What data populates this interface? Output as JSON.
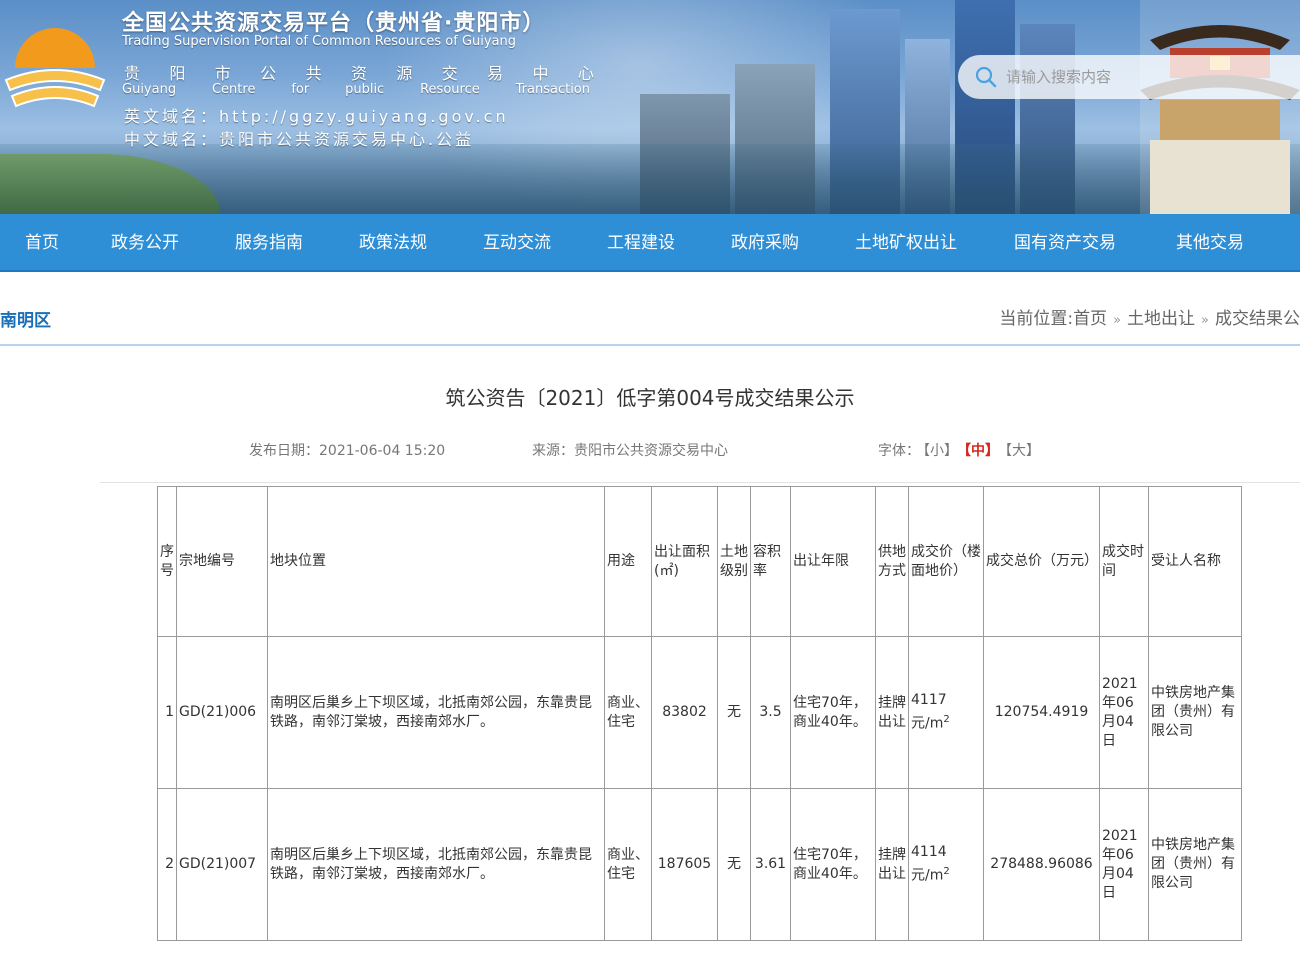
{
  "header": {
    "title": "全国公共资源交易平台（贵州省·贵阳市）",
    "subtitle": "Trading Supervision Portal of Common Resources of Guiyang",
    "center_name_cn": [
      "贵",
      "阳",
      "市",
      "公",
      "共",
      "资",
      "源",
      "交",
      "易",
      "中",
      "心"
    ],
    "center_name_en": [
      "Guiyang",
      "Centre",
      "for",
      "public",
      "Resource",
      "Transaction"
    ],
    "en_domain_label": "英文域名：",
    "en_domain": "http://ggzy.guiyang.gov.cn",
    "cn_domain_label": "中文域名：",
    "cn_domain": "贵阳市公共资源交易中心.公益",
    "search_placeholder": "请输入搜索内容"
  },
  "nav": {
    "items": [
      "首页",
      "政务公开",
      "服务指南",
      "政策法规",
      "互动交流",
      "工程建设",
      "政府采购",
      "土地矿权出让",
      "国有资产交易",
      "其他交易"
    ]
  },
  "breadcrumb": {
    "section": "南明区",
    "prefix": "当前位置:",
    "items": [
      "首页",
      "土地出让",
      "成交结果公"
    ],
    "separator": "»"
  },
  "article": {
    "title": "筑公资告〔2021〕低字第004号成交结果公示",
    "publish_label": "发布日期：",
    "publish_date": "2021-06-04 15:20",
    "source_label": "来源：",
    "source": "贵阳市公共资源交易中心",
    "font_label": "字体：",
    "font_small": "【小】",
    "font_medium": "【中】",
    "font_large": "【大】"
  },
  "table": {
    "headers": [
      "序号",
      "宗地编号",
      "地块位置",
      "用途",
      "出让面积(㎡)",
      "土地级别",
      "容积率",
      "出让年限",
      "供地方式",
      "成交价（楼面地价）",
      "成交总价（万元）",
      "成交时间",
      "受让人名称"
    ],
    "rows": [
      {
        "no": "1",
        "parcel_id": "GD(21)006",
        "location": "南明区后巢乡上下坝区域，北抵南郊公园，东靠贵昆铁路，南邻汀棠坡，西接南郊水厂。",
        "use": "商业、住宅",
        "area": "83802",
        "land_grade": "无",
        "plot_ratio": "3.5",
        "term": "住宅70年，商业40年。",
        "supply_method": "挂牌出让",
        "unit_price": "4117",
        "unit_price_unit": "元/m",
        "total_price": "120754.4919",
        "deal_time": "2021年06月04日",
        "buyer": "中铁房地产集团（贵州）有限公司"
      },
      {
        "no": "2",
        "parcel_id": "GD(21)007",
        "location": "南明区后巢乡上下坝区域，北抵南郊公园，东靠贵昆铁路，南邻汀棠坡，西接南郊水厂。",
        "use": "商业、住宅",
        "area": "187605",
        "land_grade": "无",
        "plot_ratio": "3.61",
        "term": "住宅70年，商业40年。",
        "supply_method": "挂牌出让",
        "unit_price": "4114",
        "unit_price_unit": "元/m",
        "total_price": "278488.96086",
        "deal_time": "2021年06月04日",
        "buyer": "中铁房地产集团（贵州）有限公司"
      }
    ],
    "superscript": "2"
  },
  "colors": {
    "nav_bg": "#2e8fd6",
    "section_label": "#1a6fb8",
    "active_font": "#d9261c"
  }
}
